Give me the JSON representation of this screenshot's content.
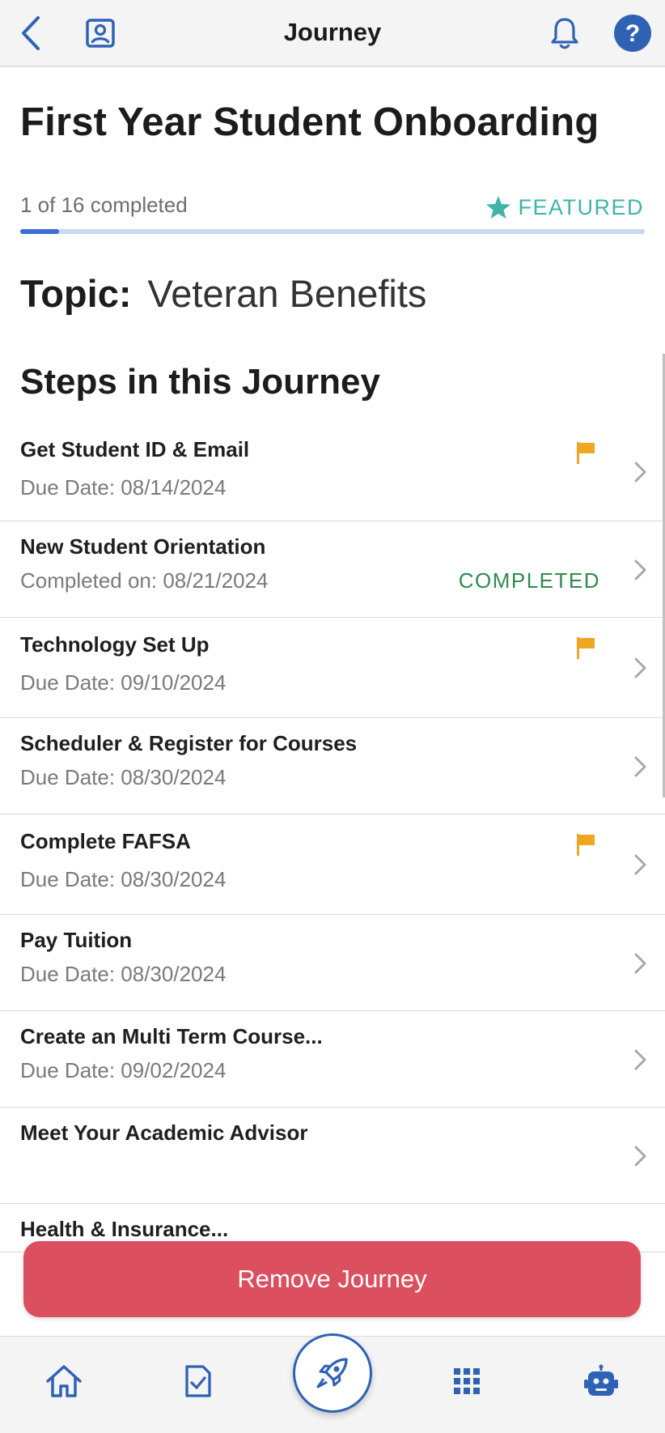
{
  "header": {
    "title": "Journey",
    "back_icon": "chevron-left-icon",
    "profile_icon": "profile-card-icon",
    "bell_icon": "bell-icon",
    "help_icon": "help-icon"
  },
  "journey": {
    "title": "First Year Student Onboarding",
    "progress_text": "1 of 16 completed",
    "progress_fraction": 0.0625,
    "featured_label": "FEATURED",
    "topic_label": "Topic:",
    "topic_value": "Veteran Benefits"
  },
  "steps_heading": "Steps in this Journey",
  "steps": [
    {
      "name": "Get Student ID & Email",
      "sub": "Due Date: 08/14/2024",
      "flagged": true,
      "status": ""
    },
    {
      "name": "New Student Orientation",
      "sub": "Completed on: 08/21/2024",
      "flagged": false,
      "status": "COMPLETED"
    },
    {
      "name": "Technology Set Up",
      "sub": "Due Date: 09/10/2024",
      "flagged": true,
      "status": ""
    },
    {
      "name": "Scheduler & Register for Courses",
      "sub": "Due Date: 08/30/2024",
      "flagged": false,
      "status": ""
    },
    {
      "name": "Complete FAFSA",
      "sub": "Due Date: 08/30/2024",
      "flagged": true,
      "status": ""
    },
    {
      "name": "Pay Tuition",
      "sub": "Due Date: 08/30/2024",
      "flagged": false,
      "status": ""
    },
    {
      "name": "Create an Multi Term Course...",
      "sub": "Due Date: 09/02/2024",
      "flagged": false,
      "status": ""
    },
    {
      "name": "Meet Your Academic Advisor",
      "sub": "",
      "flagged": false,
      "status": ""
    },
    {
      "name": "Health & Insurance...",
      "sub": "",
      "flagged": false,
      "status": ""
    }
  ],
  "actions": {
    "remove_label": "Remove Journey"
  },
  "bottom_nav": {
    "items": [
      "home-icon",
      "tasks-icon",
      "rocket-icon",
      "apps-grid-icon",
      "bot-icon"
    ]
  },
  "colors": {
    "accent_blue": "#2f62b5",
    "featured_teal": "#3fb4a8",
    "flag_orange": "#f0a623",
    "completed_green": "#2e8b4f",
    "remove_red": "#dc4f5e"
  }
}
